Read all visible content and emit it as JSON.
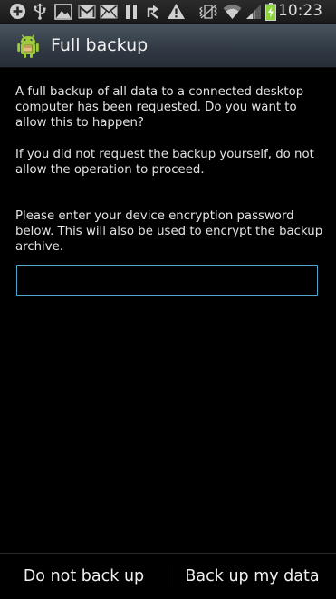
{
  "status_bar": {
    "time": "10:23",
    "icons": [
      "add-icon",
      "usb-icon",
      "image-icon",
      "gmail-icon",
      "email-icon",
      "pause-icon",
      "sync-icon",
      "warning-icon",
      "vibrate-icon",
      "wifi-icon",
      "signal-icon",
      "battery-charging-icon"
    ]
  },
  "title_bar": {
    "title": "Full backup",
    "icon": "android-icon"
  },
  "content": {
    "paragraph_1": "A full backup of all data to a connected desktop computer has been requested. Do you want to allow this to happen?",
    "paragraph_2": "If you did not request the backup yourself, do not allow the operation to proceed.",
    "paragraph_3": "Please enter your device encryption password below. This will also be used to encrypt the backup archive.",
    "password_value": "",
    "password_placeholder": ""
  },
  "buttons": {
    "deny_label": "Do not back up",
    "allow_label": "Back up my data"
  },
  "colors": {
    "input_border": "#4fa8c9",
    "title_bar": "#303943",
    "background": "#000000",
    "battery_green": "#8fd33a"
  }
}
